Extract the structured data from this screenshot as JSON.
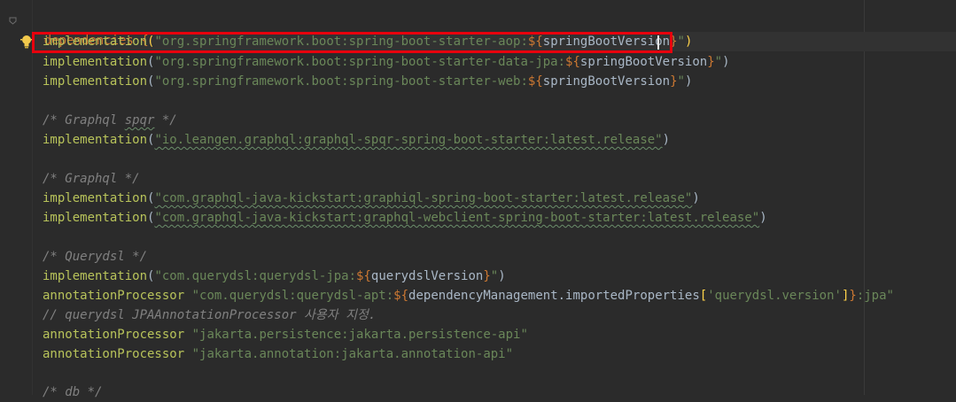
{
  "editor": {
    "lines": {
      "deps_open": "dependencies {",
      "impl_keyword": "implementation",
      "ap_keyword": "annotationProcessor",
      "impl_aop_str": "\"org.springframework.boot:spring-boot-starter-aop:",
      "impl_jpa_str": "\"org.springframework.boot:spring-boot-starter-data-jpa:",
      "impl_web_str": "\"org.springframework.boot:spring-boot-starter-web:",
      "dollar": "$",
      "brace_open": "{",
      "brace_close": "}",
      "spring_boot_version": "springBootVersion",
      "quote_close": "\"",
      "paren_open": "(",
      "paren_close": ")",
      "comment_graphql_spqr_a": "/* Graphql ",
      "comment_graphql_spqr_b": "spqr",
      "comment_graphql_spqr_c": " */",
      "impl_spqr_str": "\"io.leangen.graphql:graphql-spqr-spring-boot-starter:latest.release\"",
      "comment_graphql": "/* Graphql */",
      "impl_graphiql_str": "\"com.graphql-java-kickstart:graphiql-spring-boot-starter:latest.release\"",
      "impl_webclient_str": "\"com.graphql-java-kickstart:graphql-webclient-spring-boot-starter:latest.release\"",
      "comment_querydsl": "/* Querydsl */",
      "impl_querydsl_jpa_str": "\"com.querydsl:querydsl-jpa:",
      "querydsl_version": "querydslVersion",
      "ap_querydsl_apt_str": "\"com.querydsl:querydsl-apt:",
      "dep_mgmt": "dependencyManagement.importedProperties",
      "bracket_open": "[",
      "bracket_close": "]",
      "querydsl_version_key": "'querydsl.version'",
      "jpa_suffix": ":jpa\"",
      "comment_jpa_processor": "// querydsl JPAAnnotationProcessor 사용자 지정.",
      "ap_jakarta_persistence_str": "\"jakarta.persistence:jakarta.persistence-api\"",
      "ap_jakarta_annotation_str": "\"jakarta.annotation:jakarta.annotation-api\"",
      "comment_db": "/* db */"
    }
  },
  "colors": {
    "background": "#2b2b2b",
    "keyword": "#cc7832",
    "function": "#b8c35a",
    "string": "#6a8759",
    "comment": "#808080",
    "highlight_box": "#e8000d"
  },
  "icons": {
    "intention_bulb": "lightbulb-icon",
    "fold": "fold-marker-icon"
  }
}
